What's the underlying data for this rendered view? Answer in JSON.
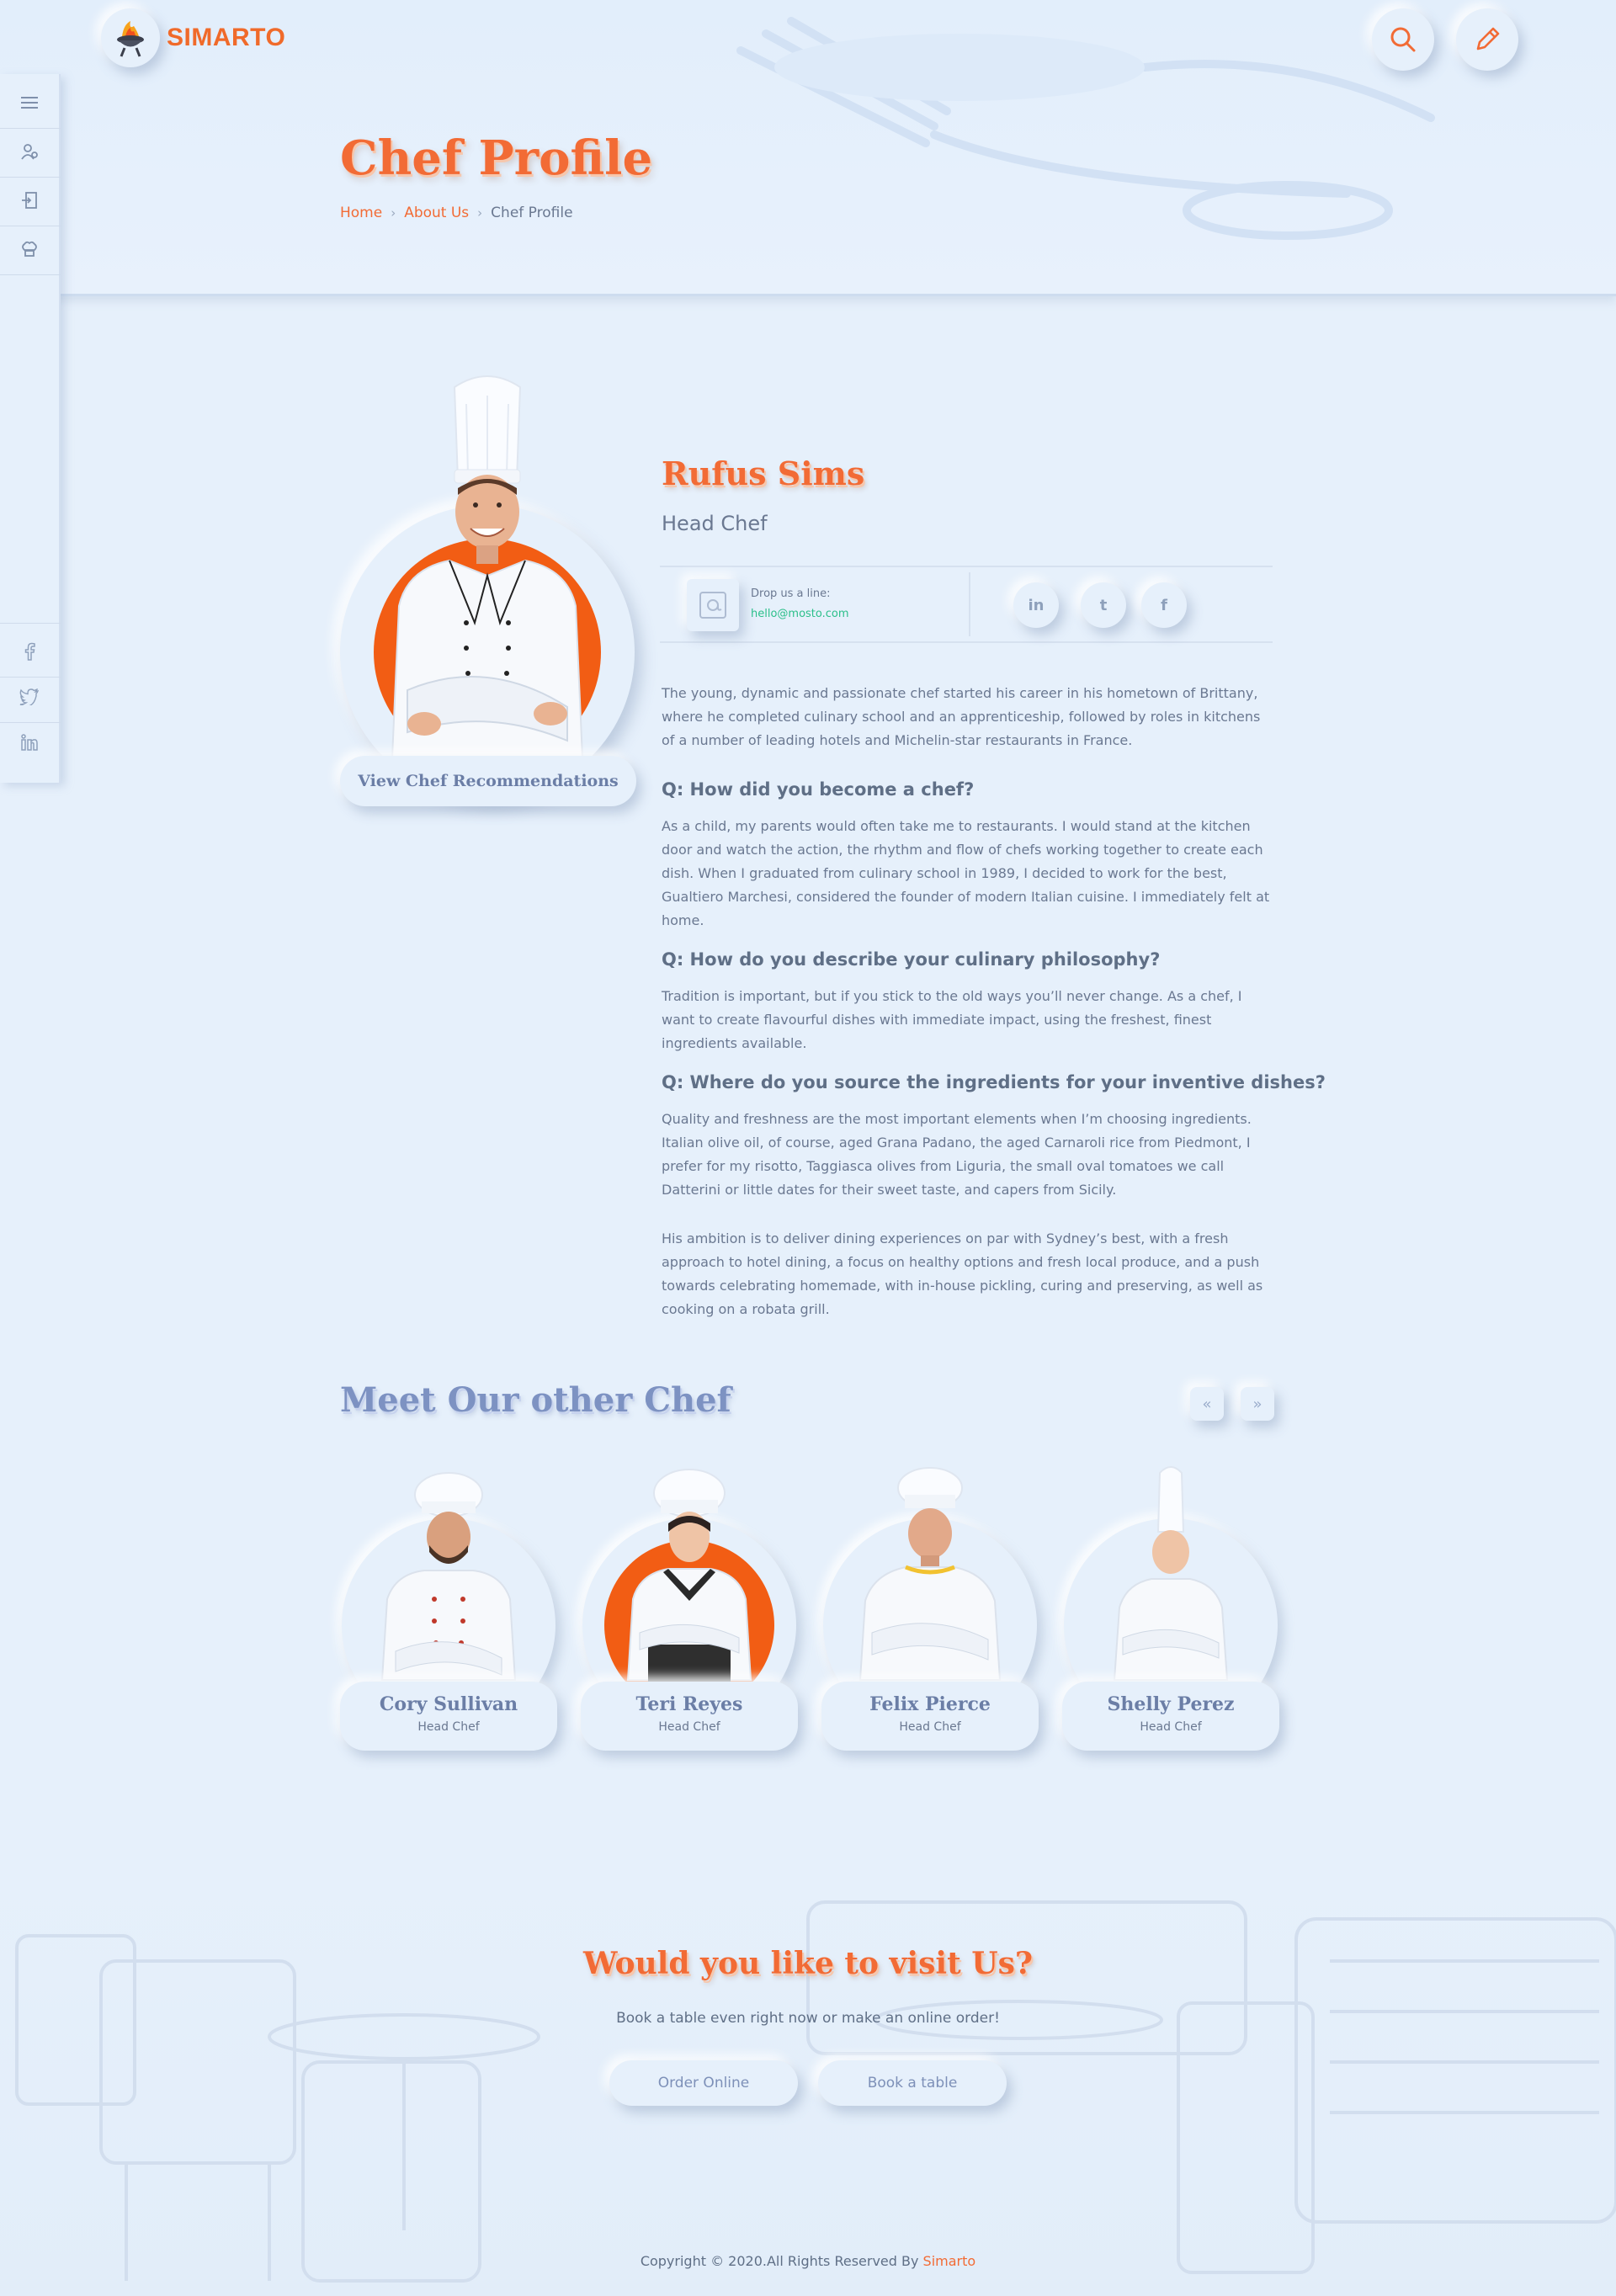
{
  "brand": {
    "name": "SIMARTO"
  },
  "header": {
    "search_icon": "search-icon",
    "edit_icon": "pencil-icon",
    "title": "Chef Profile",
    "breadcrumb": [
      "Home",
      "About Us",
      "Chef Profile"
    ]
  },
  "siderail": {
    "top_icons": [
      "menu-icon",
      "user-icon",
      "login-icon",
      "chef-hat-icon"
    ],
    "social_icons": [
      "facebook-icon",
      "twitter-icon",
      "linkedin-icon"
    ]
  },
  "profile": {
    "name": "Rufus Sims",
    "role": "Head Chef",
    "view_button": "View Chef Recommendations",
    "contact_label": "Drop us a line:",
    "contact_email": "hello@mosto.com",
    "social": {
      "linkedin": "in",
      "twitter": "t",
      "facebook": "f"
    },
    "intro": "The young, dynamic and passionate chef started his career in his hometown of Brittany, where he completed culinary school and an apprenticeship, followed by roles in kitchens of a number of leading hotels and Michelin-star restaurants in France.",
    "qa": [
      {
        "q": "Q: How did you become a chef?",
        "a": "As a child, my parents would often take me to restaurants. I would stand at the kitchen door and watch the action, the rhythm and flow of chefs working together to create each dish. When I graduated from culinary school in 1989, I decided to work for the best, Gualtiero Marchesi, considered the founder of modern Italian cuisine. I immediately felt at home."
      },
      {
        "q": "Q: How do you describe your culinary philosophy?",
        "a": "Tradition is important, but if you stick to the old ways you’ll never change. As a chef, I want to create flavourful dishes with immediate impact, using the freshest, finest ingredients available."
      },
      {
        "q": "Q: Where do you source the ingredients for your inventive dishes?",
        "a": "Quality and freshness are the most important elements when I’m choosing ingredients. Italian olive oil, of course, aged Grana Padano, the aged Carnaroli rice from Piedmont, I prefer for my risotto, Taggiasca olives from Liguria, the small oval tomatoes we call Datterini or little dates for their sweet taste, and capers from Sicily."
      }
    ],
    "closing": "His ambition is to deliver dining experiences on par with Sydney’s best, with a fresh approach to hotel dining, a focus on healthy options and fresh local produce, and a push towards celebrating homemade, with in-house pickling, curing and preserving, as well as cooking on a robata grill."
  },
  "other_chefs": {
    "title": "Meet Our other Chef",
    "prev_label": "«",
    "next_label": "»",
    "chefs": [
      {
        "name": "Cory Sullivan",
        "role": "Head Chef"
      },
      {
        "name": "Teri Reyes",
        "role": "Head Chef"
      },
      {
        "name": "Felix Pierce",
        "role": "Head Chef"
      },
      {
        "name": "Shelly Perez",
        "role": "Head Chef"
      }
    ]
  },
  "visit": {
    "title": "Would you like to visit Us?",
    "subtitle": "Book a table even right now or make an online order!",
    "order_button": "Order Online",
    "book_button": "Book a table"
  },
  "footer": {
    "copyright_prefix": "Copyright © 2020.All Rights Reserved By ",
    "copyright_brand": "Simarto"
  },
  "colors": {
    "accent": "#f26b35",
    "background": "#e6f0fb",
    "email": "#2bbf8a",
    "title_blue": "#7d92c2"
  }
}
